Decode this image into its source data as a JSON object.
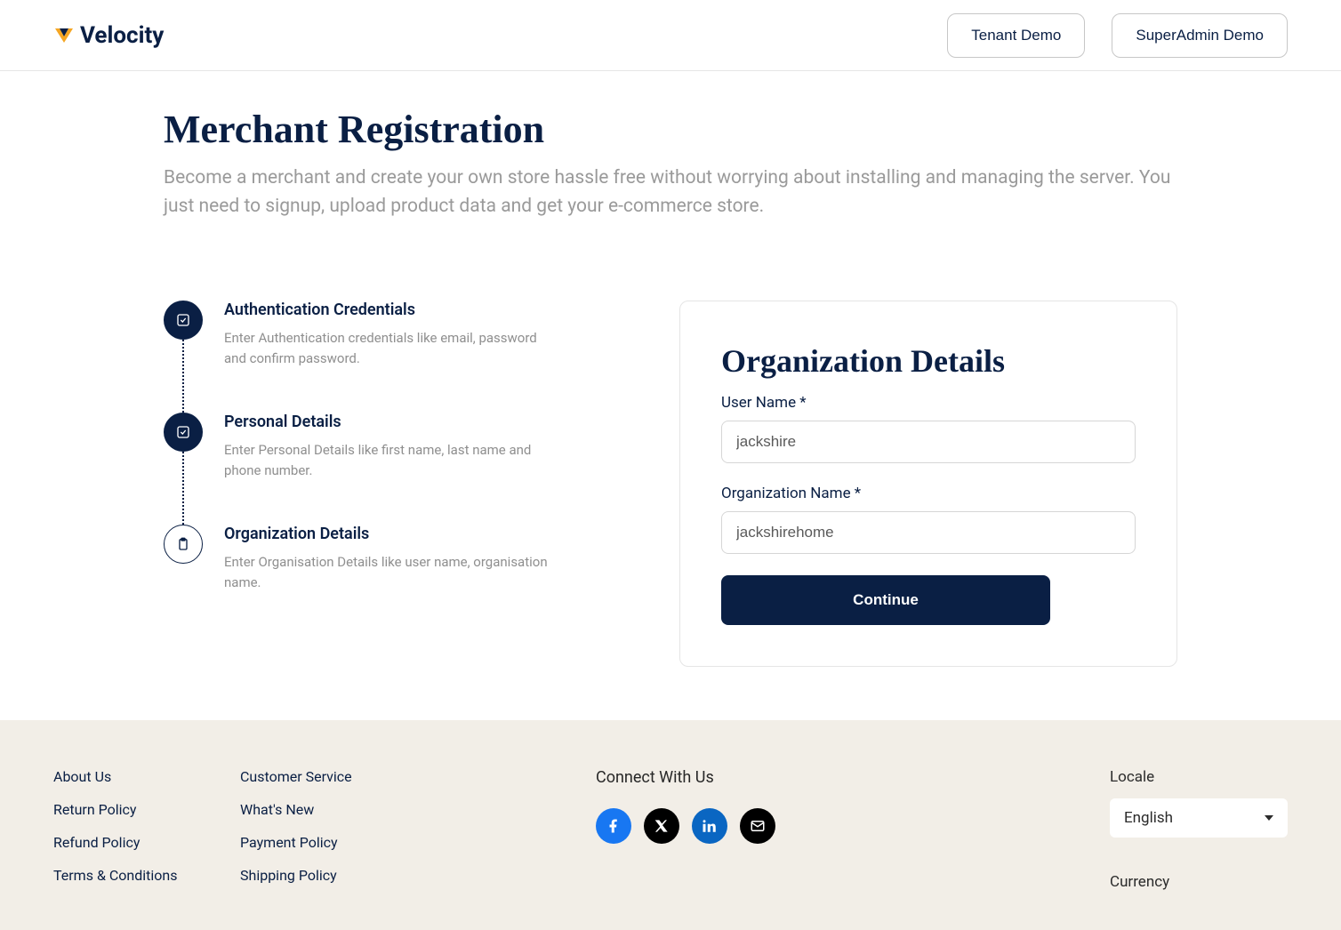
{
  "brand": {
    "name": "Velocity"
  },
  "header": {
    "tenant_btn": "Tenant Demo",
    "superadmin_btn": "SuperAdmin Demo"
  },
  "page": {
    "title": "Merchant Registration",
    "subtitle": "Become a merchant and create your own store hassle free without worrying about installing and managing the server. You just need to signup, upload product data and get your e-commerce store."
  },
  "steps": [
    {
      "title": "Authentication Credentials",
      "desc": "Enter Authentication credentials like email, password and confirm password."
    },
    {
      "title": "Personal Details",
      "desc": "Enter Personal Details like first name, last name and phone number."
    },
    {
      "title": "Organization Details",
      "desc": "Enter Organisation Details like user name, organisation name."
    }
  ],
  "form": {
    "title": "Organization Details",
    "username_label": "User Name *",
    "username_value": "jackshire",
    "orgname_label": "Organization Name *",
    "orgname_value": "jackshirehome",
    "continue_label": "Continue"
  },
  "footer": {
    "col1": [
      "About Us",
      "Return Policy",
      "Refund Policy",
      "Terms & Conditions"
    ],
    "col2": [
      "Customer Service",
      "What's New",
      "Payment Policy",
      "Shipping Policy"
    ],
    "connect_title": "Connect With Us",
    "locale_label": "Locale",
    "locale_value": "English",
    "currency_label": "Currency"
  }
}
